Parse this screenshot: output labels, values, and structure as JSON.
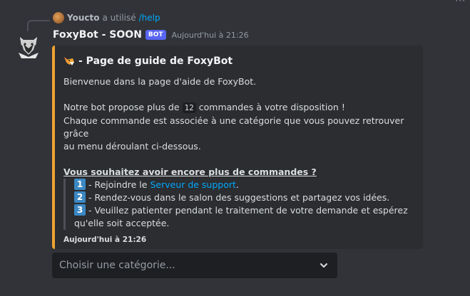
{
  "reply": {
    "user": "Youcto",
    "verb": "a utilisé",
    "command": "/help"
  },
  "message": {
    "username": "FoxyBot - SOON",
    "bot_tag": "BOT",
    "timestamp": "Aujourd'hui à 21:26"
  },
  "embed": {
    "accent_color": "#f0a232",
    "title": "- Page de guide de FoxyBot",
    "intro": "Bienvenue dans la page d'aide de FoxyBot.",
    "line1_before": "Notre bot propose plus de",
    "command_count": "12",
    "line1_after": "commandes à votre disposition !",
    "line2": "Chaque commande est associée à une catégorie que vous pouvez retrouver grâce",
    "line3": "au menu déroulant ci-dessous.",
    "subheading": "Vous souhaitez avoir encore plus de commandes ?",
    "steps": [
      {
        "num": "1",
        "before": "- Rejoindre le",
        "link": "Serveur de support",
        "after": "."
      },
      {
        "num": "2",
        "text": "- Rendez-vous dans le salon des suggestions et partagez vos idées."
      },
      {
        "num": "3",
        "text": "- Veuillez patienter pendant le traitement de votre demande et espérez",
        "text2": "qu'elle soit acceptée."
      }
    ],
    "footer": "Aujourd'hui à 21:26"
  },
  "select": {
    "placeholder": "Choisir une catégorie..."
  },
  "icons": {
    "title_icon": "fox-icon",
    "avatar": "fox-avatar",
    "chevron": "chevron-down-icon"
  }
}
